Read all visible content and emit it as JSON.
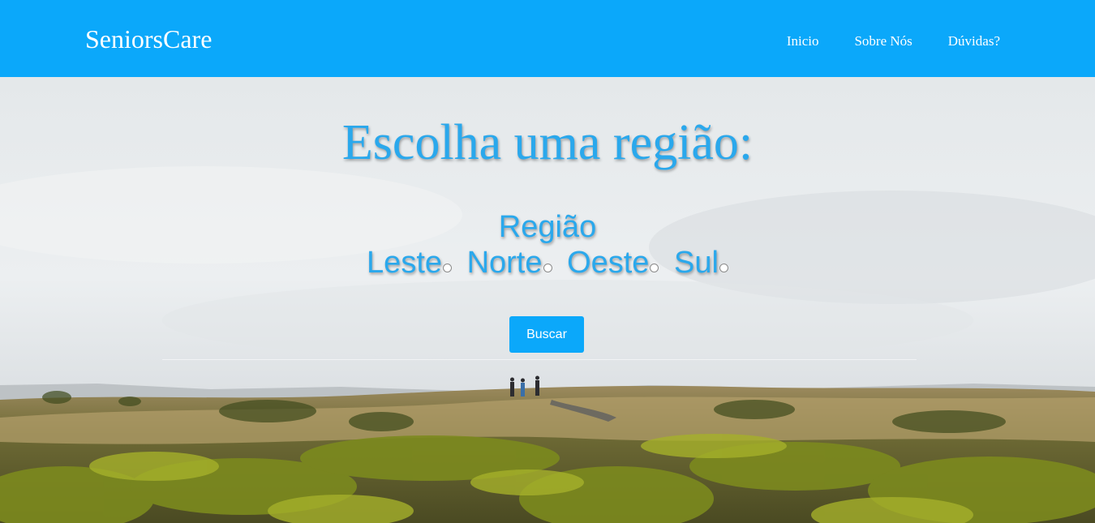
{
  "brand": "SeniorsCare",
  "nav": {
    "inicio": "Inicio",
    "sobre": "Sobre Nós",
    "duvidas": "Dúvidas?"
  },
  "hero": {
    "headline": "Escolha uma região:",
    "region_title": "Região",
    "options": {
      "leste": "Leste",
      "norte": "Norte",
      "oeste": "Oeste",
      "sul": "Sul"
    },
    "button_label": "Buscar"
  },
  "colors": {
    "primary": "#0ba8fa",
    "heading_text": "#2aa8ec"
  }
}
